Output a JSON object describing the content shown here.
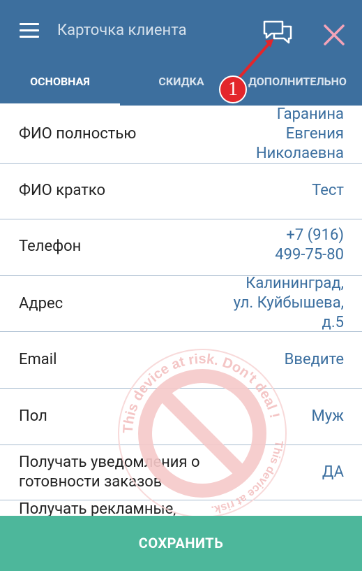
{
  "header": {
    "title": "Карточка клиента",
    "callout_number": "1"
  },
  "tabs": [
    {
      "label": "ОСНОВНАЯ",
      "active": true
    },
    {
      "label": "СКИДКА",
      "active": false
    },
    {
      "label": "ДОПОЛНИТЕЛЬНО",
      "active": false
    }
  ],
  "fields": {
    "full_name": {
      "label": "ФИО полностью",
      "value": [
        "Гаранина",
        "Евгения",
        "Николаевна"
      ]
    },
    "short_name": {
      "label": "ФИО кратко",
      "value": "Тест"
    },
    "phone": {
      "label": "Телефон",
      "value": [
        "+7 (916)",
        "499-75-80"
      ]
    },
    "address": {
      "label": "Адрес",
      "value": [
        "Калининград,",
        "ул. Куйбышева,",
        "д.5"
      ]
    },
    "email": {
      "label": "Email",
      "value": "Введите"
    },
    "gender": {
      "label": "Пол",
      "value": "Муж"
    },
    "ready_notifications": {
      "label": [
        "Получать уведомления о",
        "готовности заказов"
      ],
      "value": "ДА"
    },
    "ads": {
      "label": "Получать рекламные,"
    }
  },
  "watermark": {
    "text_top": "This device at risk. Don't deal !",
    "text_side": "This device at risk. Don't deal !"
  },
  "footer": {
    "save_label": "СОХРАНИТЬ"
  },
  "colors": {
    "primary": "#3d6f9e",
    "accent": "#4db79b",
    "value_text": "#3a6e9f",
    "callout": "#e3262b",
    "close_icon": "#f4a3b8"
  }
}
